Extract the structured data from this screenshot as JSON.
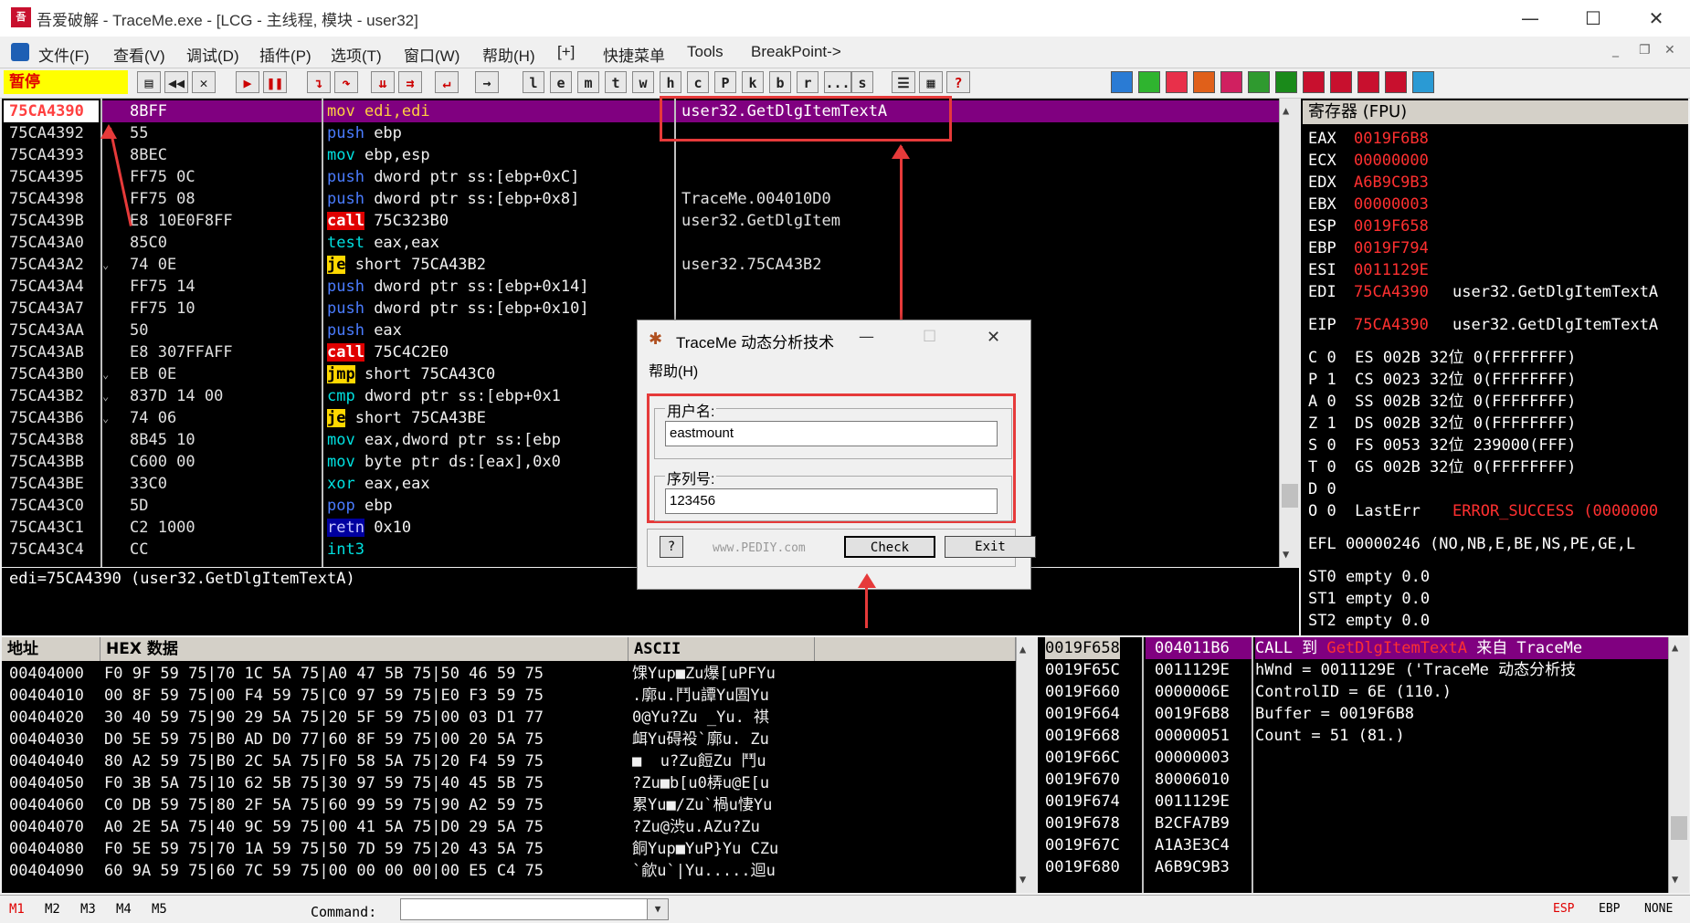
{
  "window": {
    "title": "吾爱破解 - TraceMe.exe - [LCG - 主线程, 模块 - user32]"
  },
  "menu": [
    "文件(F)",
    "查看(V)",
    "调试(D)",
    "插件(P)",
    "选项(T)",
    "窗口(W)",
    "帮助(H)",
    "[+]",
    "快捷菜单",
    "Tools",
    "BreakPoint->"
  ],
  "status_state": "暂停",
  "toolbar_letters": [
    "l",
    "e",
    "m",
    "t",
    "w",
    "h",
    "c",
    "P",
    "k",
    "b",
    "r",
    "...",
    "s"
  ],
  "disasm": [
    {
      "addr": "75CA4390",
      "hex": "8BFF",
      "asm": "mov edi,edi",
      "cmt": "user32.GetDlgItemTextA"
    },
    {
      "addr": "75CA4392",
      "hex": "55",
      "asm": "push ebp",
      "cmt": ""
    },
    {
      "addr": "75CA4393",
      "hex": "8BEC",
      "asm": "mov ebp,esp",
      "cmt": ""
    },
    {
      "addr": "75CA4395",
      "hex": "FF75 0C",
      "asm": "push dword ptr ss:[ebp+0xC]",
      "cmt": ""
    },
    {
      "addr": "75CA4398",
      "hex": "FF75 08",
      "asm": "push dword ptr ss:[ebp+0x8]",
      "cmt": "TraceMe.004010D0"
    },
    {
      "addr": "75CA439B",
      "hex": "E8 10E0F8FF",
      "asm": "call 75C323B0",
      "cmt": "user32.GetDlgItem"
    },
    {
      "addr": "75CA43A0",
      "hex": "85C0",
      "asm": "test eax,eax",
      "cmt": ""
    },
    {
      "addr": "75CA43A2",
      "hex": "74 0E",
      "asm": "je short 75CA43B2",
      "cmt": "user32.75CA43B2"
    },
    {
      "addr": "75CA43A4",
      "hex": "FF75 14",
      "asm": "push dword ptr ss:[ebp+0x14]",
      "cmt": ""
    },
    {
      "addr": "75CA43A7",
      "hex": "FF75 10",
      "asm": "push dword ptr ss:[ebp+0x10]",
      "cmt": ""
    },
    {
      "addr": "75CA43AA",
      "hex": "50",
      "asm": "push eax",
      "cmt": ""
    },
    {
      "addr": "75CA43AB",
      "hex": "E8 307FFAFF",
      "asm": "call 75C4C2E0",
      "cmt": ""
    },
    {
      "addr": "75CA43B0",
      "hex": "EB 0E",
      "asm": "jmp short 75CA43C0",
      "cmt": ""
    },
    {
      "addr": "75CA43B2",
      "hex": "837D 14 00",
      "asm": "cmp dword ptr ss:[ebp+0x1",
      "cmt": ""
    },
    {
      "addr": "75CA43B6",
      "hex": "74 06",
      "asm": "je short 75CA43BE",
      "cmt": ""
    },
    {
      "addr": "75CA43B8",
      "hex": "8B45 10",
      "asm": "mov eax,dword ptr ss:[ebp",
      "cmt": ""
    },
    {
      "addr": "75CA43BB",
      "hex": "C600 00",
      "asm": "mov byte ptr ds:[eax],0x0",
      "cmt": ""
    },
    {
      "addr": "75CA43BE",
      "hex": "33C0",
      "asm": "xor eax,eax",
      "cmt": ""
    },
    {
      "addr": "75CA43C0",
      "hex": "5D",
      "asm": "pop ebp",
      "cmt": ""
    },
    {
      "addr": "75CA43C1",
      "hex": "C2 1000",
      "asm": "retn 0x10",
      "cmt": ""
    },
    {
      "addr": "75CA43C4",
      "hex": "CC",
      "asm": "int3",
      "cmt": ""
    }
  ],
  "info_line": "edi=75CA4390 (user32.GetDlgItemTextA)",
  "registers": {
    "title": "寄存器 (FPU)",
    "gp": [
      {
        "n": "EAX",
        "v": "0019F6B8",
        "c": ""
      },
      {
        "n": "ECX",
        "v": "00000000",
        "c": ""
      },
      {
        "n": "EDX",
        "v": "A6B9C9B3",
        "c": ""
      },
      {
        "n": "EBX",
        "v": "00000003",
        "c": ""
      },
      {
        "n": "ESP",
        "v": "0019F658",
        "c": ""
      },
      {
        "n": "EBP",
        "v": "0019F794",
        "c": ""
      },
      {
        "n": "ESI",
        "v": "0011129E",
        "c": ""
      },
      {
        "n": "EDI",
        "v": "75CA4390",
        "c": "user32.GetDlgItemTextA"
      }
    ],
    "eip": {
      "n": "EIP",
      "v": "75CA4390",
      "c": "user32.GetDlgItemTextA"
    },
    "flags": [
      "C 0  ES 002B 32位 0(FFFFFFFF)",
      "P 1  CS 0023 32位 0(FFFFFFFF)",
      "A 0  SS 002B 32位 0(FFFFFFFF)",
      "Z 1  DS 002B 32位 0(FFFFFFFF)",
      "S 0  FS 0053 32位 239000(FFF)",
      "T 0  GS 002B 32位 0(FFFFFFFF)",
      "D 0",
      "O 0  LastErr "
    ],
    "lasterr": "ERROR_SUCCESS (0000000",
    "efl": "EFL 00000246 (NO,NB,E,BE,NS,PE,GE,L",
    "st": [
      "ST0 empty 0.0",
      "ST1 empty 0.0",
      "ST2 empty 0.0"
    ]
  },
  "dump": {
    "headers": {
      "addr": "地址",
      "hex": "HEX 数据",
      "ascii": "ASCII"
    },
    "rows": [
      {
        "addr": "00404000",
        "hex": "F0 9F 59 75|70 1C 5A 75|A0 47 5B 75|50 46 59 75",
        "ascii": "馃Yup■Zu爆[uPFYu"
      },
      {
        "addr": "00404010",
        "hex": "00 8F 59 75|00 F4 59 75|C0 97 59 75|E0 F3 59 75",
        "ascii": ".廓u.鬥u譚Yu圄Yu"
      },
      {
        "addr": "00404020",
        "hex": "30 40 59 75|90 29 5A 75|20 5F 59 75|00 03 D1 77",
        "ascii": "0@Yu?Zu _Yu. 祺"
      },
      {
        "addr": "00404030",
        "hex": "D0 5E 59 75|B0 AD D0 77|60 8F 59 75|00 20 5A 75",
        "ascii": "衈Yu碍祋`廓u. Zu"
      },
      {
        "addr": "00404040",
        "hex": "80 A2 59 75|B0 2C 5A 75|F0 58 5A 75|20 F4 59 75",
        "ascii": "■  u?Zu餖Zu 鬥u"
      },
      {
        "addr": "00404050",
        "hex": "F0 3B 5A 75|10 62 5B 75|30 97 59 75|40 45 5B 75",
        "ascii": "?Zu■b[u0梇u@E[u"
      },
      {
        "addr": "00404060",
        "hex": "C0 DB 59 75|80 2F 5A 75|60 99 59 75|90 A2 59 75",
        "ascii": "累Yu■/Zu`楇u悽Yu"
      },
      {
        "addr": "00404070",
        "hex": "A0 2E 5A 75|40 9C 59 75|00 41 5A 75|D0 29 5A 75",
        "ascii": "?Zu@渋u.AZu?Zu"
      },
      {
        "addr": "00404080",
        "hex": "F0 5E 59 75|70 1A 59 75|50 7D 59 75|20 43 5A 75",
        "ascii": "餇Yup■YuP}Yu CZu"
      },
      {
        "addr": "00404090",
        "hex": "60 9A 59 75|60 7C 59 75|00 00 00 00|00 E5 C4 75",
        "ascii": "`歈u`|Yu.....迴u"
      }
    ]
  },
  "stack": {
    "rows": [
      {
        "a": "0019F658",
        "v": "004011B6",
        "c": "CALL 到 "
      },
      {
        "a": "0019F65C",
        "v": "0011129E",
        "c": "hWnd = 0011129E ('TraceMe 动态分析技"
      },
      {
        "a": "0019F660",
        "v": "0000006E",
        "c": "ControlID = 6E (110.)"
      },
      {
        "a": "0019F664",
        "v": "0019F6B8",
        "c": "Buffer = 0019F6B8"
      },
      {
        "a": "0019F668",
        "v": "00000051",
        "c": "Count = 51 (81.)"
      },
      {
        "a": "0019F66C",
        "v": "00000003",
        "c": ""
      },
      {
        "a": "0019F670",
        "v": "80006010",
        "c": ""
      },
      {
        "a": "0019F674",
        "v": "0011129E",
        "c": ""
      },
      {
        "a": "0019F678",
        "v": "B2CFA7B9",
        "c": ""
      },
      {
        "a": "0019F67C",
        "v": "A1A3E3C4",
        "c": ""
      },
      {
        "a": "0019F680",
        "v": "A6B9C9B3",
        "c": ""
      }
    ],
    "call_func": "GetDlgItemTextA",
    "call_from": " 来自 TraceMe"
  },
  "dialog": {
    "title": "TraceMe 动态分析技术",
    "menu": "帮助(H)",
    "user_label": "用户名:",
    "user_value": "eastmount",
    "serial_label": "序列号:",
    "serial_value": "123456",
    "help_btn": "?",
    "site": "www.PEDIY.com",
    "check_btn": "Check",
    "exit_btn": "Exit"
  },
  "statusbar": {
    "marks": [
      "M1",
      "M2",
      "M3",
      "M4",
      "M5"
    ],
    "command_label": "Command:",
    "right": [
      "ESP",
      "EBP",
      "NONE"
    ]
  },
  "colors": {
    "highlight": "#800080",
    "annot_red": "#e63a3a",
    "pane_bg": "#000000"
  }
}
